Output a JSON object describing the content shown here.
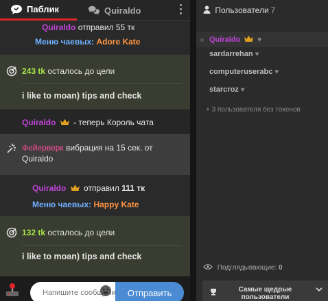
{
  "tabs": {
    "public_label": "Паблик",
    "user_label": "Quiraldo"
  },
  "messages": {
    "tip1": {
      "user": "Quiraldo",
      "action": "отправил",
      "amount": "55 тк",
      "menu_label": "Меню чаевых:",
      "item": "Adore Kate"
    },
    "goal1": {
      "remaining": "243 tk",
      "remaining_text": "осталось до цели",
      "goal_text": "i like to moan) tips and check"
    },
    "king": {
      "user": "Quiraldo",
      "text": "- теперь Король чата"
    },
    "firework": {
      "label": "Фейерверк",
      "text1": "вибрация на",
      "seconds": "15 сек.",
      "text2": "от",
      "user": "Quiraldo"
    },
    "tip2": {
      "user": "Quiraldo",
      "action": "отправил",
      "amount": "111 тк",
      "menu_label": "Меню чаевых:",
      "item": "Happy Kate"
    },
    "goal2": {
      "remaining": "132 tk",
      "remaining_text": "осталось до цели",
      "goal_text": "i like to moan) tips and check"
    }
  },
  "input": {
    "placeholder": "Напишите сообщение",
    "send_label": "Отправить"
  },
  "users": {
    "header": "Пользователи",
    "count": "7",
    "list": [
      "Quiraldo",
      "sardarrehan",
      "computeruserabc",
      "starcroz"
    ],
    "no_token_text": "+ 3 пользователя без токенов",
    "watchers_label": "Подглядывающие:",
    "watchers_count": "0",
    "top_button": [
      "Самые щедрые",
      "пользователи"
    ]
  },
  "colors": {
    "accent_red": "#e0262b",
    "send_blue": "#4a8bd4",
    "goal_green": "#a8e64a",
    "username_purple": "#c045d8",
    "menu_blue": "#6fb0ff",
    "item_orange": "#ff9544"
  }
}
